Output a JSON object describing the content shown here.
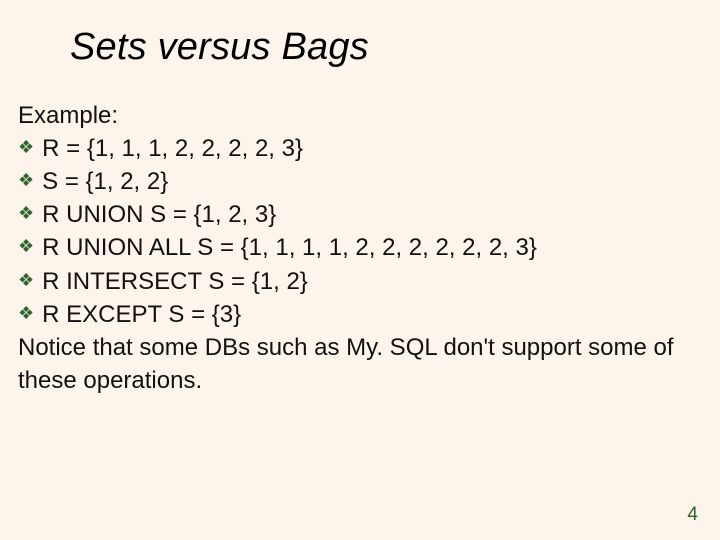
{
  "title": "Sets versus Bags",
  "example_label": "Example:",
  "bullets": [
    "R = {1, 1, 1, 2, 2, 2, 2, 3}",
    "S = {1, 2, 2}",
    "R UNION S = {1, 2, 3}",
    "R UNION ALL S = {1, 1, 1, 1, 2, 2, 2, 2, 2, 2, 3}",
    "R INTERSECT S = {1, 2}",
    "R EXCEPT S = {3}"
  ],
  "notice": "Notice that some DBs such as My. SQL don't support some of these operations.",
  "page_number": "4",
  "bullet_glyph": "❖"
}
